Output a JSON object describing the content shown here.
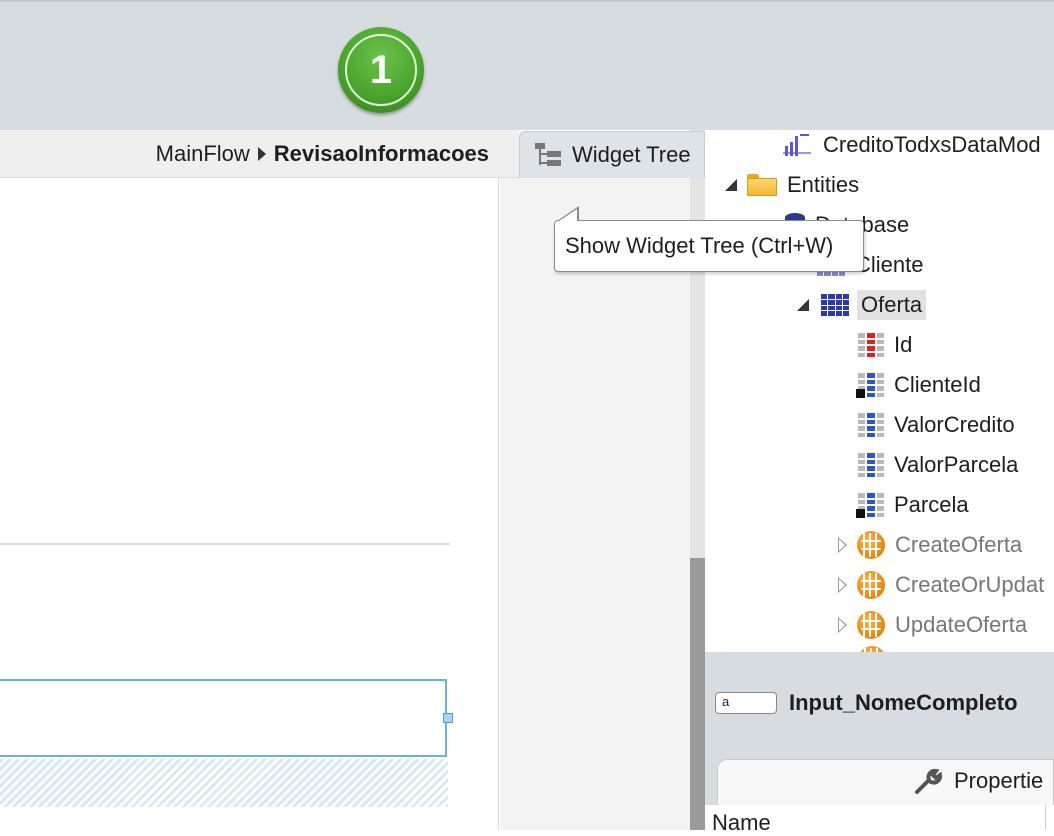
{
  "step": {
    "number": "1"
  },
  "breadcrumb": {
    "flow": "MainFlow",
    "screen": "RevisaoInformacoes"
  },
  "widget_tree_tab": {
    "label": "Widget Tree"
  },
  "tooltip": {
    "text": "Show Widget Tree (Ctrl+W)"
  },
  "tree": {
    "items": [
      {
        "label": "CreditoTodxsDataMod",
        "icon": "data-model-icon"
      },
      {
        "label": "Entities",
        "icon": "folder-icon"
      },
      {
        "label": "Database",
        "icon": "database-icon"
      },
      {
        "label": "Cliente",
        "icon": "entity-icon"
      },
      {
        "label": "Oferta",
        "icon": "entity-icon"
      },
      {
        "label": "Id",
        "icon": "primary-key-attribute-icon"
      },
      {
        "label": "ClienteId",
        "icon": "foreign-key-attribute-icon"
      },
      {
        "label": "ValorCredito",
        "icon": "attribute-icon"
      },
      {
        "label": "ValorParcela",
        "icon": "attribute-icon"
      },
      {
        "label": "Parcela",
        "icon": "foreign-key-attribute-icon"
      },
      {
        "label": "CreateOferta",
        "icon": "entity-action-icon"
      },
      {
        "label": "CreateOrUpdat",
        "icon": "entity-action-icon"
      },
      {
        "label": "UpdateOferta",
        "icon": "entity-action-icon"
      }
    ]
  },
  "properties": {
    "widget_type_glyph": "a",
    "widget_name": "Input_NomeCompleto",
    "tab_label": "Propertie",
    "name_label": "Name"
  },
  "colors": {
    "step_badge": "#4aa52c",
    "selection_border": "#6ab0e8",
    "entity_action": "#f08a12"
  }
}
